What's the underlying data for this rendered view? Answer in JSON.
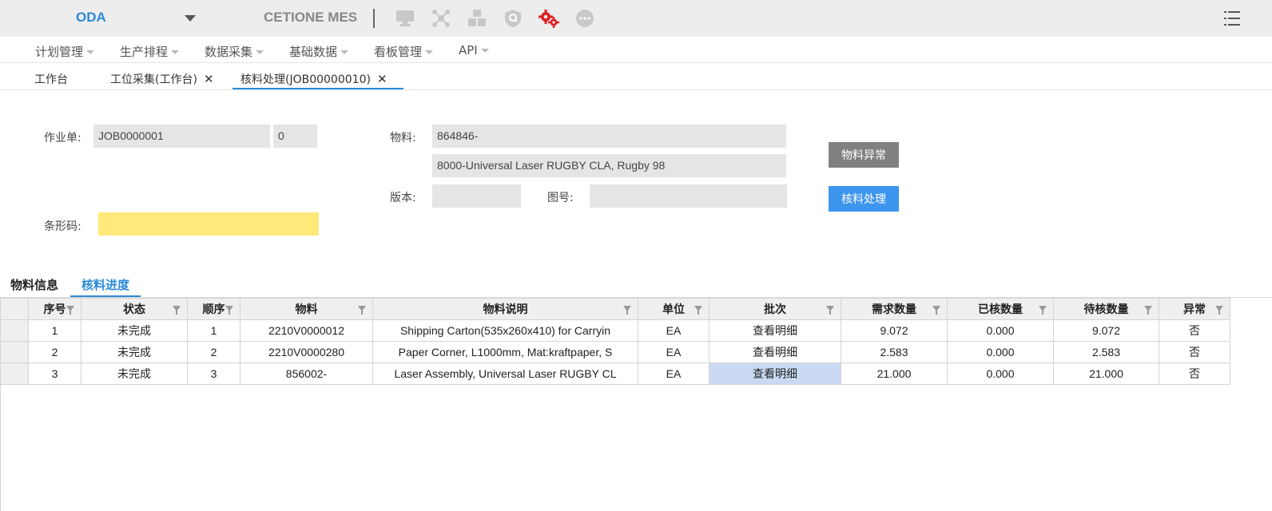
{
  "header": {
    "brand": "ODA",
    "app_title": "CETIONE MES",
    "tool_icons": [
      "monitor-icon",
      "network-icon",
      "cubes-icon",
      "shield-search-icon",
      "gears-icon",
      "more-icon"
    ],
    "accent_color": "#2a8ad8",
    "active_tool_color": "#e02020"
  },
  "menu": {
    "items": [
      {
        "label": "计划管理"
      },
      {
        "label": "生产排程"
      },
      {
        "label": "数据采集"
      },
      {
        "label": "基础数据"
      },
      {
        "label": "看板管理"
      },
      {
        "label": "API"
      }
    ]
  },
  "tabs": [
    {
      "label": "工作台",
      "closable": false
    },
    {
      "label": "工位采集(工作台)",
      "closable": true
    },
    {
      "label": "核料处理(JOB00000010)",
      "closable": true,
      "active": true
    }
  ],
  "form": {
    "job_label": "作业单:",
    "job_value": "JOB0000001",
    "job_seq": "0",
    "material_label": "物料:",
    "material_code": "864846-",
    "material_desc": "8000-Universal Laser RUGBY CLA, Rugby 98",
    "version_label": "版本:",
    "version_value": "",
    "drawing_label": "图号:",
    "drawing_value": "",
    "barcode_label": "条形码:",
    "barcode_value": "",
    "btn_material_exception": "物料异常",
    "btn_check_process": "核料处理"
  },
  "subtabs": [
    {
      "label": "物料信息"
    },
    {
      "label": "核料进度",
      "active": true
    }
  ],
  "grid": {
    "columns": [
      "序号",
      "状态",
      "顺序",
      "物料",
      "物料说明",
      "单位",
      "批次",
      "需求数量",
      "已核数量",
      "待核数量",
      "异常"
    ],
    "rows": [
      [
        "1",
        "未完成",
        "1",
        "2210V0000012",
        "Shipping Carton(535x260x410) for Carryin",
        "EA",
        "查看明细",
        "9.072",
        "0.000",
        "9.072",
        "否"
      ],
      [
        "2",
        "未完成",
        "2",
        "2210V0000280",
        "Paper Corner, L1000mm, Mat:kraftpaper, S",
        "EA",
        "查看明细",
        "2.583",
        "0.000",
        "2.583",
        "否"
      ],
      [
        "3",
        "未完成",
        "3",
        "856002-",
        "Laser Assembly, Universal Laser RUGBY CL",
        "EA",
        "查看明细",
        "21.000",
        "0.000",
        "21.000",
        "否"
      ]
    ]
  }
}
